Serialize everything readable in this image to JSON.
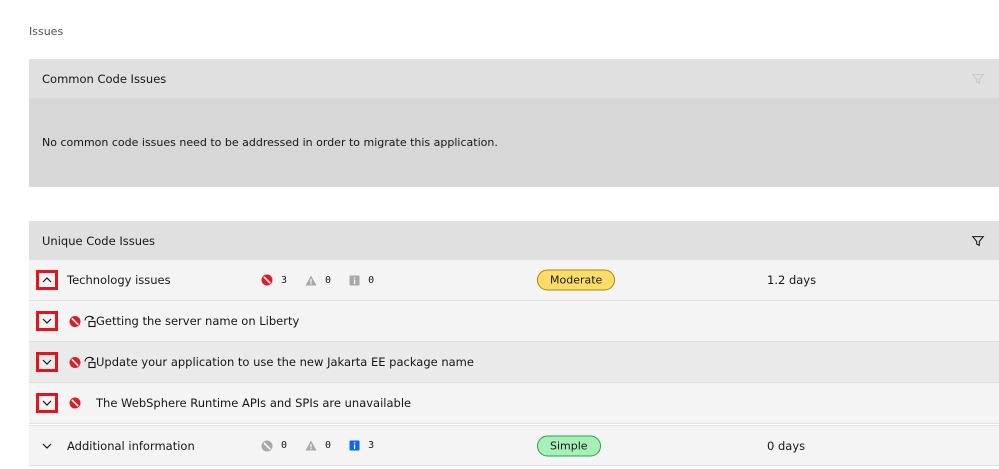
{
  "page": {
    "label": "Issues"
  },
  "common": {
    "title": "Common Code Issues",
    "empty_message": "No common code issues need to be addressed in order to migrate this application."
  },
  "unique": {
    "title": "Unique Code Issues",
    "technology": {
      "label": "Technology issues",
      "critical": "3",
      "warning": "0",
      "info": "0",
      "complexity": "Moderate",
      "effort": "1.2 days"
    },
    "issues": [
      {
        "label": "Getting the server name on Liberty"
      },
      {
        "label": "Update your application to use the new Jakarta EE package name"
      },
      {
        "label": "The WebSphere Runtime APIs and SPIs are unavailable"
      }
    ],
    "additional": {
      "label": "Additional information",
      "critical": "0",
      "warning": "0",
      "info": "3",
      "complexity": "Simple",
      "effort": "0 days"
    }
  },
  "colors": {
    "critical": "#da1e28",
    "warning_inactive": "#a8a8a8",
    "info_active": "#0f62fe",
    "highlight": "#e3141c"
  }
}
